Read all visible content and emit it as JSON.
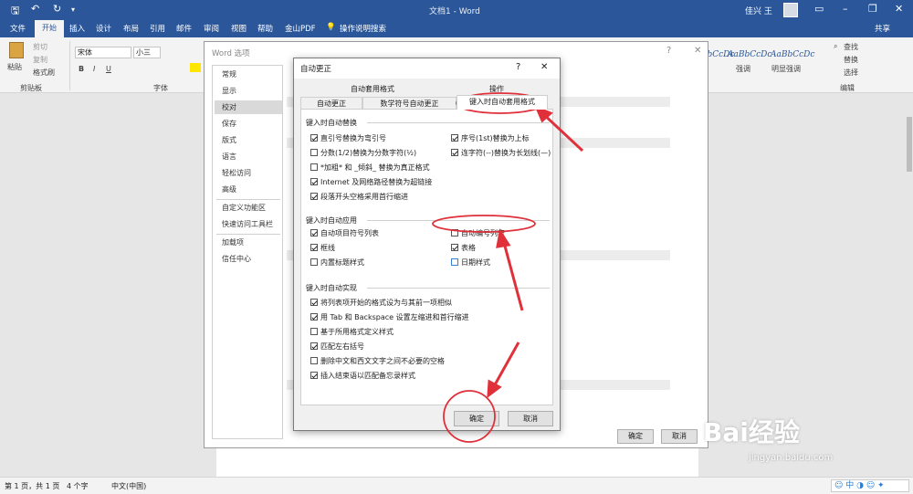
{
  "titlebar": {
    "doc_title": "文档1 - Word",
    "user": "佳兴 王",
    "share": "共享"
  },
  "menu": {
    "file": "文件",
    "home": "开始",
    "insert": "插入",
    "design": "设计",
    "layout": "布局",
    "references": "引用",
    "mailings": "邮件",
    "review": "审阅",
    "view": "视图",
    "help": "帮助",
    "wps": "金山PDF",
    "tellme": "操作说明搜索"
  },
  "ribbon": {
    "paste": "粘贴",
    "cut": "剪切",
    "copy": "复制",
    "format_painter": "格式刷",
    "clipboard": "剪贴板",
    "font_name": "宋体",
    "font_size": "小三",
    "font_group": "字体",
    "styles": [
      "AaBbCcDc",
      "AaBbCcDc",
      "AaBbCcDc"
    ],
    "style_names": [
      "强调",
      "明显强调"
    ],
    "find": "查找",
    "replace": "替换",
    "select": "选择",
    "editing": "编辑"
  },
  "options_dialog": {
    "title": "Word 选项",
    "help": "?",
    "categories": [
      "常规",
      "显示",
      "校对",
      "保存",
      "版式",
      "语言",
      "轻松访问",
      "高级",
      "自定义功能区",
      "快速访问工具栏",
      "加载项",
      "信任中心"
    ],
    "selected": "校对",
    "ok": "确定",
    "cancel": "取消"
  },
  "autocorrect": {
    "title": "自动更正",
    "help": "?",
    "tabs_top": [
      "自动套用格式",
      "操作"
    ],
    "tabs_bottom": [
      "自动更正",
      "数学符号自动更正",
      "键入时自动套用格式"
    ],
    "section1": "键入时自动替换",
    "s1_left": [
      {
        "label": "直引号替换为弯引号",
        "checked": true
      },
      {
        "label": "分数(1/2)替换为分数字符(½)",
        "checked": false
      },
      {
        "label": "*加粗* 和 _倾斜_ 替换为真正格式",
        "checked": false
      },
      {
        "label": "Internet 及网络路径替换为超链接",
        "checked": true
      },
      {
        "label": "段落开头空格采用首行缩进",
        "checked": true
      }
    ],
    "s1_right": [
      {
        "label": "序号(1st)替换为上标",
        "checked": true
      },
      {
        "label": "连字符(--)替换为长划线(—)",
        "checked": true
      }
    ],
    "section2": "键入时自动应用",
    "s2_left": [
      {
        "label": "自动项目符号列表",
        "checked": true
      },
      {
        "label": "框线",
        "checked": true
      },
      {
        "label": "内置标题样式",
        "checked": false
      }
    ],
    "s2_right": [
      {
        "label": "自动编号列表",
        "checked": false
      },
      {
        "label": "表格",
        "checked": true
      },
      {
        "label": "日期样式",
        "checked": false
      }
    ],
    "section3": "键入时自动实现",
    "s3": [
      {
        "label": "将列表项开始的格式设为与其前一项相似",
        "checked": true
      },
      {
        "label": "用 Tab 和 Backspace 设置左缩进和首行缩进",
        "checked": true
      },
      {
        "label": "基于所用格式定义样式",
        "checked": false
      },
      {
        "label": "匹配左右括号",
        "checked": true
      },
      {
        "label": "删除中文和西文文字之间不必要的空格",
        "checked": false
      },
      {
        "label": "插入结束语以匹配备忘录样式",
        "checked": true
      }
    ],
    "ok": "确定",
    "cancel": "取消"
  },
  "status": {
    "page": "第 1 页，共 1 页",
    "words": "4 个字",
    "lang": "中文(中国)"
  },
  "watermark": {
    "brand": "Bai经验",
    "url": "jingyan.baidu.com"
  },
  "colors": {
    "accent": "#2b579a",
    "annotation": "#e0303a"
  }
}
